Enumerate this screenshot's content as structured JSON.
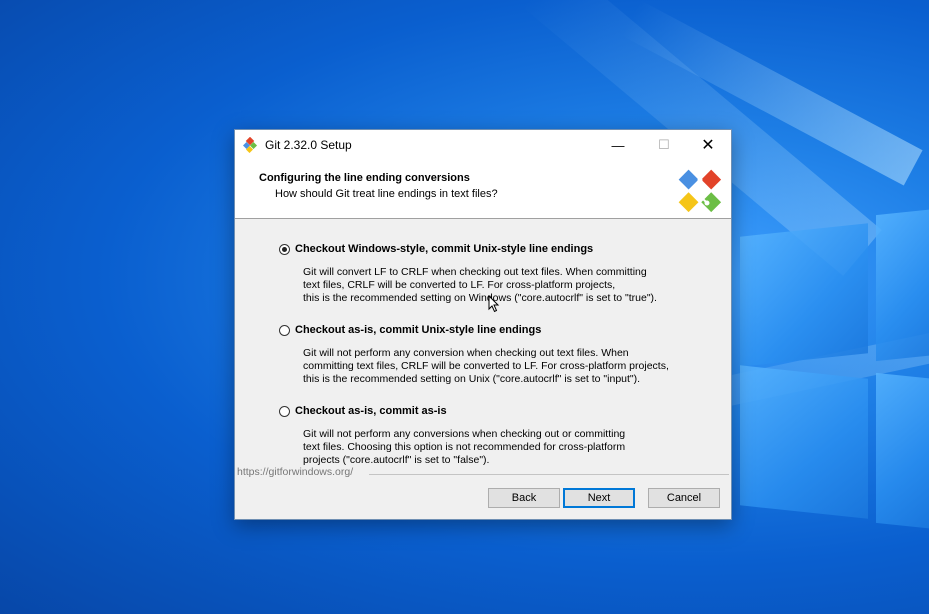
{
  "window": {
    "title": "Git 2.32.0 Setup",
    "minimize_icon": "minimize-icon",
    "maximize_icon": "maximize-icon",
    "close_icon": "close-icon"
  },
  "header": {
    "title": "Configuring the line ending conversions",
    "subtitle": "How should Git treat line endings in text files?",
    "logo": "git-logo"
  },
  "options": [
    {
      "label": "Checkout Windows-style, commit Unix-style line endings",
      "selected": true,
      "description": [
        "Git will convert LF to CRLF when checking out text files. When committing",
        "text files, CRLF will be converted to LF. For cross-platform projects,",
        "this is the recommended setting on Windows (\"core.autocrlf\" is set to \"true\")."
      ]
    },
    {
      "label": "Checkout as-is, commit Unix-style line endings",
      "selected": false,
      "description": [
        "Git will not perform any conversion when checking out text files. When",
        "committing text files, CRLF will be converted to LF. For cross-platform projects,",
        "this is the recommended setting on Unix (\"core.autocrlf\" is set to \"input\")."
      ]
    },
    {
      "label": "Checkout as-is, commit as-is",
      "selected": false,
      "description": [
        "Git will not perform any conversions when checking out or committing",
        "text files. Choosing this option is not recommended for cross-platform",
        "projects (\"core.autocrlf\" is set to \"false\")."
      ]
    }
  ],
  "footer": {
    "link": "https://gitforwindows.org/",
    "back_label": "Back",
    "next_label": "Next",
    "cancel_label": "Cancel"
  },
  "colors": {
    "desktop": "#0a5fcf",
    "default_button_border": "#0078d7"
  }
}
